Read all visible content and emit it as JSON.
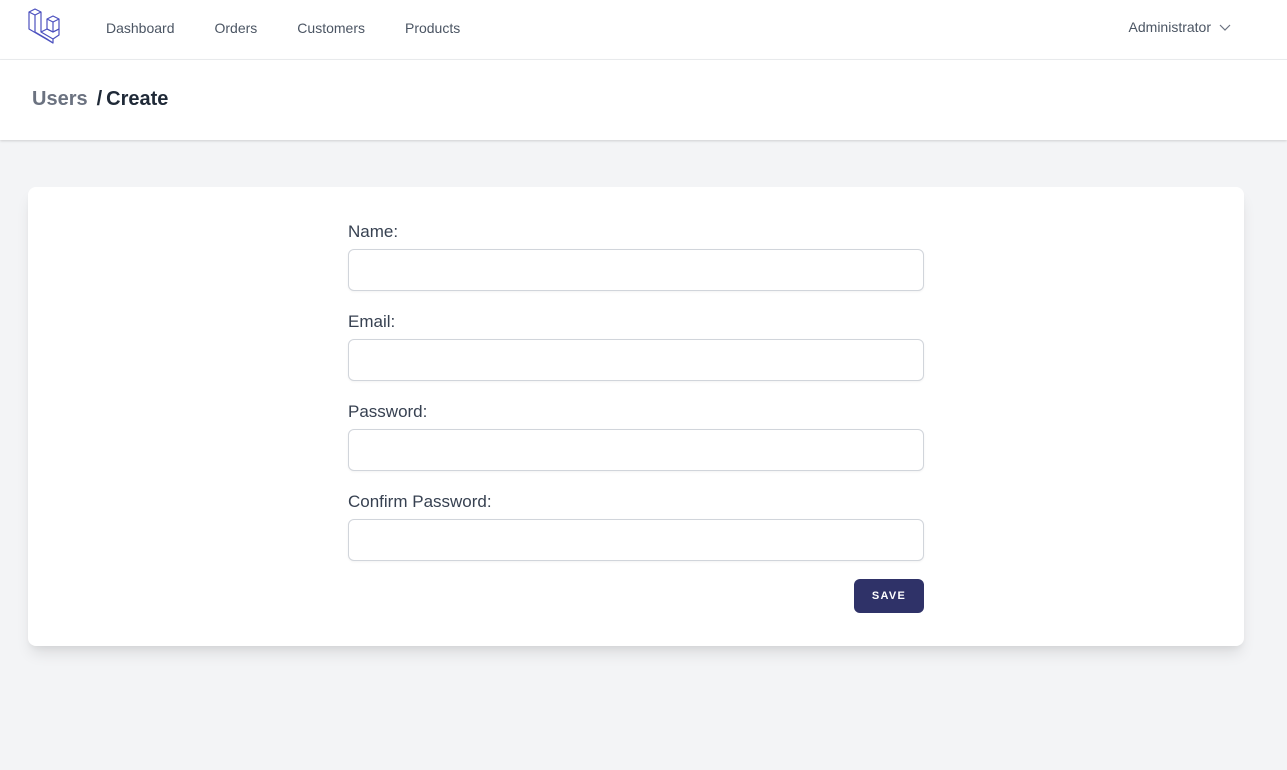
{
  "nav": {
    "logo_icon": "laravel-logo-icon",
    "links": [
      "Dashboard",
      "Orders",
      "Customers",
      "Products"
    ],
    "user": "Administrator",
    "user_icon": "chevron-down-icon"
  },
  "header": {
    "parent": "Users",
    "separator": "/",
    "current": "Create"
  },
  "form": {
    "name_label": "Name:",
    "name_value": "",
    "email_label": "Email:",
    "email_value": "",
    "password_label": "Password:",
    "password_value": "",
    "confirm_label": "Confirm Password:",
    "confirm_value": "",
    "save_label": "SAVE"
  },
  "colors": {
    "accent": "#2f3268",
    "background": "#f3f4f6",
    "card": "#ffffff"
  }
}
